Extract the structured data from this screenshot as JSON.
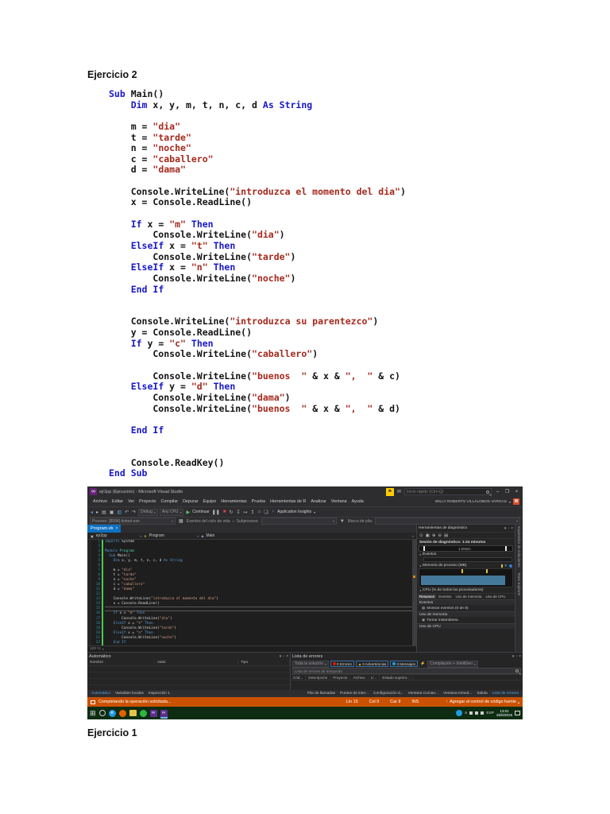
{
  "page": {
    "heading_top": "Ejercicio 2",
    "heading_bottom": "Ejercicio 1"
  },
  "doc_code": {
    "keyword_color": "#1717c9",
    "string_color": "#a5291d",
    "lines": [
      [
        [
          "k",
          "Sub "
        ],
        [
          "p",
          "Main()"
        ]
      ],
      [
        [
          "p",
          "    "
        ],
        [
          "k",
          "Dim "
        ],
        [
          "p",
          "x, y, m, t, n, c, d "
        ],
        [
          "k",
          "As String"
        ]
      ],
      [],
      [
        [
          "p",
          "    m = "
        ],
        [
          "s",
          "\"dia\""
        ]
      ],
      [
        [
          "p",
          "    t = "
        ],
        [
          "s",
          "\"tarde\""
        ]
      ],
      [
        [
          "p",
          "    n = "
        ],
        [
          "s",
          "\"noche\""
        ]
      ],
      [
        [
          "p",
          "    c = "
        ],
        [
          "s",
          "\"caballero\""
        ]
      ],
      [
        [
          "p",
          "    d = "
        ],
        [
          "s",
          "\"dama\""
        ]
      ],
      [],
      [
        [
          "p",
          "    Console.WriteLine("
        ],
        [
          "s",
          "\"introduzca el momento del dia\""
        ],
        [
          "p",
          ")"
        ]
      ],
      [
        [
          "p",
          "    x = Console.ReadLine()"
        ]
      ],
      [],
      [
        [
          "p",
          "    "
        ],
        [
          "k",
          "If"
        ],
        [
          "p",
          " x = "
        ],
        [
          "s",
          "\"m\""
        ],
        [
          "k",
          " Then"
        ]
      ],
      [
        [
          "p",
          "        Console.WriteLine("
        ],
        [
          "s",
          "\"dia\""
        ],
        [
          "p",
          ")"
        ]
      ],
      [
        [
          "p",
          "    "
        ],
        [
          "k",
          "ElseIf"
        ],
        [
          "p",
          " x = "
        ],
        [
          "s",
          "\"t\""
        ],
        [
          "k",
          " Then"
        ]
      ],
      [
        [
          "p",
          "        Console.WriteLine("
        ],
        [
          "s",
          "\"tarde\""
        ],
        [
          "p",
          ")"
        ]
      ],
      [
        [
          "p",
          "    "
        ],
        [
          "k",
          "ElseIf"
        ],
        [
          "p",
          " x = "
        ],
        [
          "s",
          "\"n\""
        ],
        [
          "k",
          " Then"
        ]
      ],
      [
        [
          "p",
          "        Console.WriteLine("
        ],
        [
          "s",
          "\"noche\""
        ],
        [
          "p",
          ")"
        ]
      ],
      [
        [
          "p",
          "    "
        ],
        [
          "k",
          "End If"
        ]
      ],
      [],
      [],
      [
        [
          "p",
          "    Console.WriteLine("
        ],
        [
          "s",
          "\"introduzca su parentezco\""
        ],
        [
          "p",
          ")"
        ]
      ],
      [
        [
          "p",
          "    y = Console.ReadLine()"
        ]
      ],
      [
        [
          "p",
          "    "
        ],
        [
          "k",
          "If"
        ],
        [
          "p",
          " y = "
        ],
        [
          "s",
          "\"c\""
        ],
        [
          "k",
          " Then"
        ]
      ],
      [
        [
          "p",
          "        Console.WriteLine("
        ],
        [
          "s",
          "\"caballero\""
        ],
        [
          "p",
          ")"
        ]
      ],
      [],
      [
        [
          "p",
          "        Console.WriteLine("
        ],
        [
          "s",
          "\"buenos  \""
        ],
        [
          "p",
          " & x & "
        ],
        [
          "s",
          "\",  \""
        ],
        [
          "p",
          " & c)"
        ]
      ],
      [
        [
          "p",
          "    "
        ],
        [
          "k",
          "ElseIf"
        ],
        [
          "p",
          " y = "
        ],
        [
          "s",
          "\"d\""
        ],
        [
          "k",
          " Then"
        ]
      ],
      [
        [
          "p",
          "        Console.WriteLine("
        ],
        [
          "s",
          "\"dama\""
        ],
        [
          "p",
          ")"
        ]
      ],
      [
        [
          "p",
          "        Console.WriteLine("
        ],
        [
          "s",
          "\"buenos  \""
        ],
        [
          "p",
          " & x & "
        ],
        [
          "s",
          "\",  \""
        ],
        [
          "p",
          " & d)"
        ]
      ],
      [],
      [
        [
          "p",
          "    "
        ],
        [
          "k",
          "End If"
        ]
      ],
      [],
      [],
      [
        [
          "p",
          "    Console.ReadKey()"
        ]
      ],
      [
        [
          "k",
          "End Sub"
        ]
      ]
    ]
  },
  "vs": {
    "title": "ejr2pp (Ejecución) - Microsoft Visual Studio",
    "quick_launch": "Inicio rápido (Ctrl+Q)",
    "menus": [
      "Archivo",
      "Editar",
      "Ver",
      "Proyecto",
      "Compilar",
      "Depurar",
      "Equipo",
      "Herramientas",
      "Prueba",
      "Herramientas de R",
      "Analizar",
      "Ventana",
      "Ayuda"
    ],
    "user": "WILLY ROBERTS VILLALOBOS VARGAS",
    "avatar_initial": "W",
    "toolbar": {
      "debug": "Debug",
      "cpu": "Any CPU",
      "continue_label": "Continuar",
      "app_insights": "Application Insights"
    },
    "debugbar": {
      "process": "Proceso: [8084] dotnet.exe",
      "lifecycle": "Eventos del ciclo de vida",
      "subprocess": "Subproceso:",
      "stack_frame": "Marco de pila:"
    },
    "editor": {
      "tab": "Program.vb",
      "breadcrumb": [
        "ejr2pp",
        "Program",
        "Main"
      ],
      "zoom": "100 %",
      "current_line": 15,
      "lines": [
        [
          [
            "w",
            "Imports "
          ],
          [
            "n",
            "System"
          ]
        ],
        [],
        [
          [
            "w",
            "Module "
          ],
          [
            "g",
            "Program"
          ]
        ],
        [
          [
            "n",
            "  "
          ],
          [
            "w",
            "Sub "
          ],
          [
            "n",
            "Main()"
          ]
        ],
        [
          [
            "n",
            "    "
          ],
          [
            "w",
            "Dim "
          ],
          [
            "n",
            "x, y, m, t, n, c, d "
          ],
          [
            "w",
            "As String"
          ]
        ],
        [],
        [
          [
            "n",
            "    m = "
          ],
          [
            "o",
            "\"dia\""
          ]
        ],
        [
          [
            "n",
            "    t = "
          ],
          [
            "o",
            "\"tarde\""
          ]
        ],
        [
          [
            "n",
            "    n = "
          ],
          [
            "o",
            "\"noche\""
          ]
        ],
        [
          [
            "n",
            "    c = "
          ],
          [
            "o",
            "\"caballero\""
          ]
        ],
        [
          [
            "n",
            "    d = "
          ],
          [
            "o",
            "\"dama\""
          ]
        ],
        [],
        [
          [
            "n",
            "    Console.WriteLine("
          ],
          [
            "o",
            "\"introduzca el momento del dia\""
          ],
          [
            "n",
            ")"
          ]
        ],
        [
          [
            "n",
            "    x = Console.ReadLine()"
          ]
        ],
        [],
        [
          [
            "n",
            "    "
          ],
          [
            "w",
            "If"
          ],
          [
            "n",
            " x = "
          ],
          [
            "o",
            "\"m\""
          ],
          [
            "w",
            " Then"
          ]
        ],
        [
          [
            "n",
            "        Console.WriteLine("
          ],
          [
            "o",
            "\"dia\""
          ],
          [
            "n",
            ")"
          ]
        ],
        [
          [
            "n",
            "    "
          ],
          [
            "w",
            "ElseIf"
          ],
          [
            "n",
            " x = "
          ],
          [
            "o",
            "\"t\""
          ],
          [
            "w",
            " Then"
          ]
        ],
        [
          [
            "n",
            "        Console.WriteLine("
          ],
          [
            "o",
            "\"tarde\""
          ],
          [
            "n",
            ")"
          ]
        ],
        [
          [
            "n",
            "    "
          ],
          [
            "w",
            "ElseIf"
          ],
          [
            "n",
            " x = "
          ],
          [
            "o",
            "\"n\""
          ],
          [
            "w",
            " Then"
          ]
        ],
        [
          [
            "n",
            "        Console.WriteLine("
          ],
          [
            "o",
            "\"noche\""
          ],
          [
            "n",
            ")"
          ]
        ],
        [
          [
            "n",
            "    "
          ],
          [
            "w",
            "End If"
          ]
        ]
      ]
    },
    "diag": {
      "title": "Herramientas de diagnóstico",
      "session": "Sesión de diagnóstico: 1:24 minutos",
      "time_label": "1:20min",
      "events_label": "Eventos",
      "memory_label": "Memoria de proceso (MB)",
      "cpu_label": "CPU (% de todos los procesadores)",
      "tabs": [
        "Resumen",
        "Eventos",
        "Uso de memoria",
        "Uso de CPU"
      ],
      "events_section": "Eventos",
      "show_events": "Mostrar eventos (0 de 8)",
      "memory_section": "Uso de memoria",
      "take_snapshot": "Tomar instantánea",
      "cpu_section": "Uso de CPU"
    },
    "side_tabs": [
      "Explorador de soluciones",
      "Team Explorer"
    ],
    "autos": {
      "title": "Automático",
      "columns": [
        "Nombre",
        "Valor",
        "Tipo"
      ]
    },
    "errors": {
      "title": "Lista de errores",
      "scope": "Toda la solución",
      "errors": "0 Errores",
      "warnings": "0 Advertencias",
      "messages": "0 Mensajes",
      "build_filter": "Compilación + IntelliSen",
      "search": "Lista de errores de búsqueda",
      "columns": [
        "Cód...",
        "Descripción",
        "Proyecto",
        "Archivo",
        "Lí...",
        "Estado suprimi..."
      ]
    },
    "paneltabs": {
      "left": [
        "Automático",
        "Variables locales",
        "Inspección 1"
      ],
      "right": [
        "Pila de llamadas",
        "Puntos de inter...",
        "Configuración d...",
        "Ventana Coman...",
        "Ventana Inmed...",
        "Salida",
        "Lista de errores"
      ]
    },
    "status": {
      "message": "Completando la operación solicitada...",
      "line": "Lín 15",
      "col": "Col 9",
      "ch": "Car 9",
      "ins": "INS",
      "source_control": "Agregar al control de código fuente",
      "bar_color": "#ca5100"
    },
    "taskbar": {
      "lang": "ESP",
      "time": "13:01",
      "date": "25/5/2019"
    }
  }
}
